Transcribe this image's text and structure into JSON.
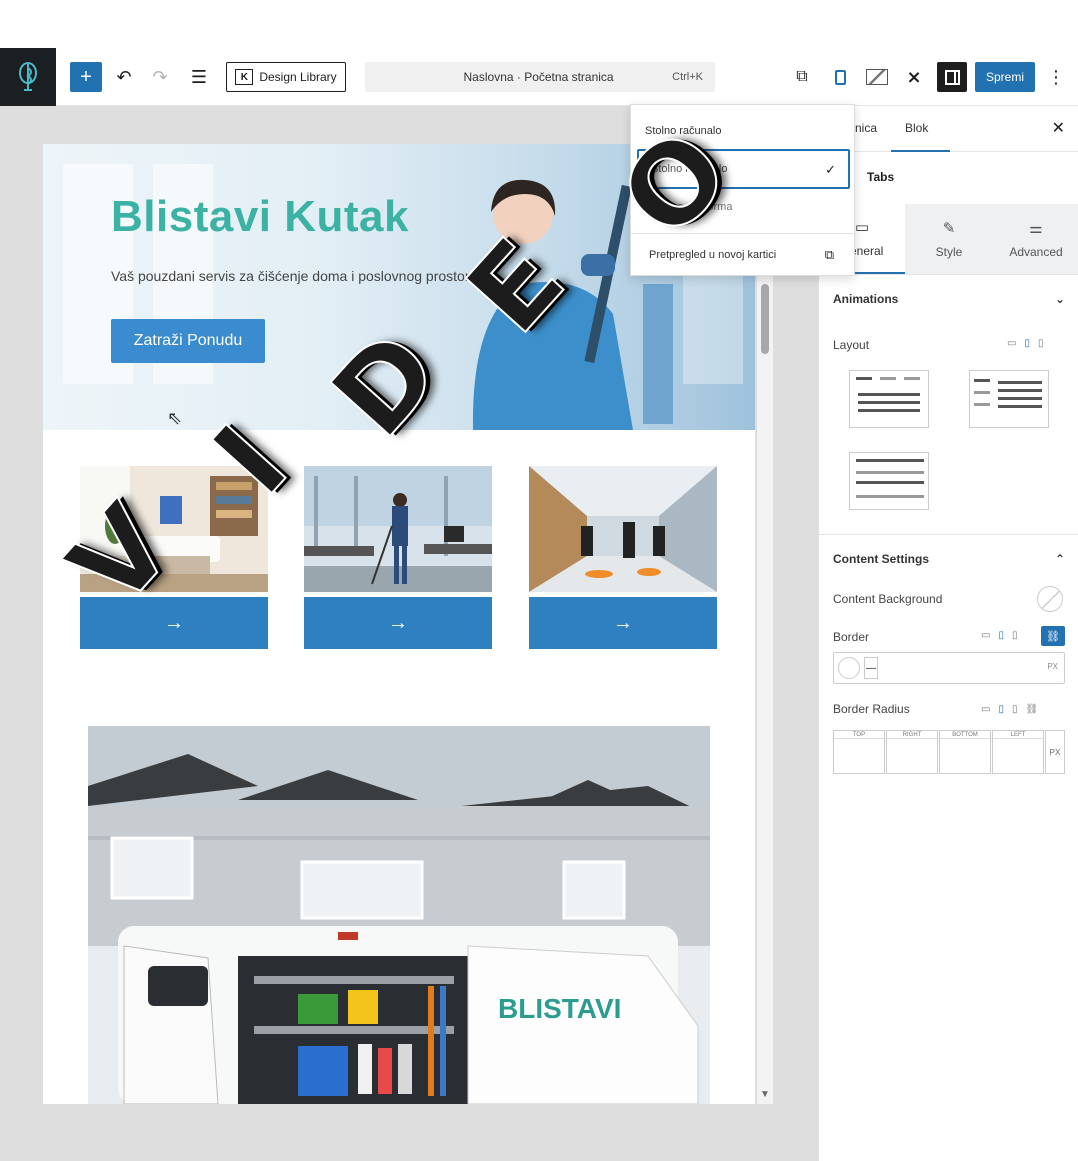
{
  "toolbar": {
    "add_icon": "+",
    "undo_icon": "↶",
    "redo_icon": "↷",
    "listview_icon": "☰",
    "design_library_label": "Design Library",
    "document_title": "Naslovna · Početna stranica",
    "shortcut": "Ctrl+K",
    "save_label": "Spremi",
    "more_icon": "⋮"
  },
  "preview_menu": {
    "heading": "Stolno računalo",
    "selected_option": "Stolno računalo",
    "option_3": "Mobilna platforma",
    "open_new_tab": "Pretpregled u novoj kartici"
  },
  "hero": {
    "title": "Blistavi Kutak",
    "subtitle": "Vaš pouzdani servis za čišćenje doma i poslovnog prostora",
    "button": "Zatraži Ponudu"
  },
  "cards": [
    {
      "arrow": "→"
    },
    {
      "arrow": "→"
    },
    {
      "arrow": "→"
    }
  ],
  "van_brand": "BLISTAVI",
  "sidebar": {
    "tab_page": "Stranica",
    "tab_block": "Blok",
    "close_icon": "✕",
    "block_name": "Tabs",
    "inner_tabs": [
      "General",
      "Style",
      "Advanced"
    ],
    "animations": "Animations",
    "layout": "Layout",
    "content_settings": "Content Settings",
    "content_background": "Content Background",
    "border": "Border",
    "border_unit": "PX",
    "border_radius": "Border Radius",
    "radius_labels": [
      "TOP",
      "RIGHT",
      "BOTTOM",
      "LEFT"
    ],
    "radius_unit": "PX"
  },
  "overlay_text": [
    "V",
    "I",
    "D",
    "E",
    "O"
  ],
  "colors": {
    "accent": "#2271b1",
    "hero_title": "#3bb2a3",
    "hero_button": "#3a8ccf",
    "card_bar": "#2f80c0"
  }
}
